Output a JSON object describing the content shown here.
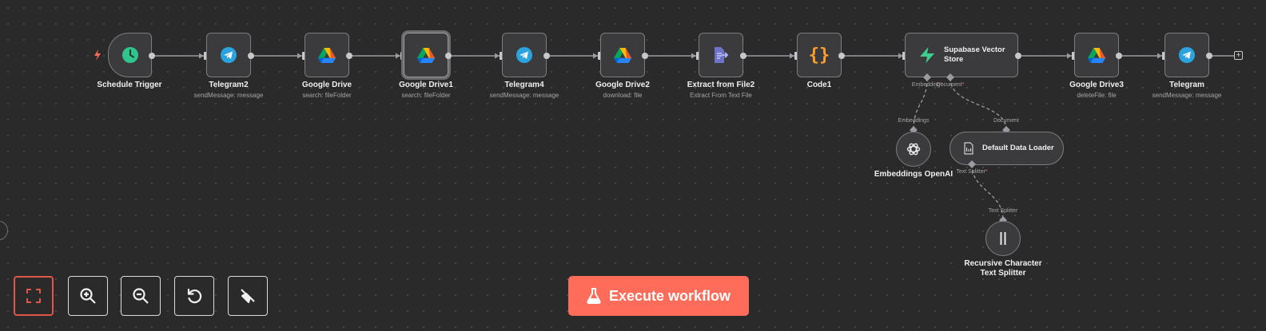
{
  "canvas": {
    "colors": {
      "background": "#2a2a2b",
      "node": "#3b3b3d",
      "border": "#7d7d80",
      "accent": "#ff6d5a"
    }
  },
  "nodes": {
    "schedule_trigger": {
      "title": "Schedule Trigger",
      "icon": "clock-icon"
    },
    "telegram2": {
      "title": "Telegram2",
      "subtitle": "sendMessage: message",
      "icon": "telegram-icon"
    },
    "google_drive": {
      "title": "Google Drive",
      "subtitle": "search: fileFolder",
      "icon": "google-drive-icon"
    },
    "google_drive1": {
      "title": "Google Drive1",
      "subtitle": "search: fileFolder",
      "icon": "google-drive-icon"
    },
    "telegram4": {
      "title": "Telegram4",
      "subtitle": "sendMessage: message",
      "icon": "telegram-icon"
    },
    "google_drive2": {
      "title": "Google Drive2",
      "subtitle": "download: file",
      "icon": "google-drive-icon"
    },
    "extract_from_file2": {
      "title": "Extract from File2",
      "subtitle": "Extract From Text File",
      "icon": "file-extract-icon"
    },
    "code1": {
      "title": "Code1",
      "icon": "code-braces-icon"
    },
    "supabase": {
      "title_line1": "Supabase Vector",
      "title_line2": "Store",
      "icon": "supabase-icon"
    },
    "google_drive3": {
      "title": "Google Drive3",
      "subtitle": "deleteFile: file",
      "icon": "google-drive-icon"
    },
    "telegram": {
      "title": "Telegram",
      "subtitle": "sendMessage: message",
      "icon": "telegram-icon"
    },
    "embeddings_openai": {
      "title": "Embeddings OpenAI",
      "icon": "openai-icon"
    },
    "default_data_loader": {
      "title": "Default Data Loader",
      "icon": "document-loader-icon"
    },
    "text_splitter": {
      "title_line1": "Recursive Character",
      "title_line2": "Text Splitter",
      "icon": "text-splitter-icon"
    }
  },
  "ports": {
    "supabase_embedding": "Embedding",
    "supabase_document": "Document",
    "required_mark": "*",
    "embeddings_out": "Embeddings",
    "loader_document": "Document",
    "loader_text_splitter": "Text Splitter",
    "splitter_out": "Text Splitter"
  },
  "controls": {
    "fit_view": "fit-view-icon",
    "zoom_in": "zoom-in-icon",
    "zoom_out": "zoom-out-icon",
    "reset_zoom": "reset-icon",
    "tidy_up": "broom-icon"
  },
  "execute_button": {
    "label": "Execute workflow",
    "icon": "flask-icon"
  }
}
